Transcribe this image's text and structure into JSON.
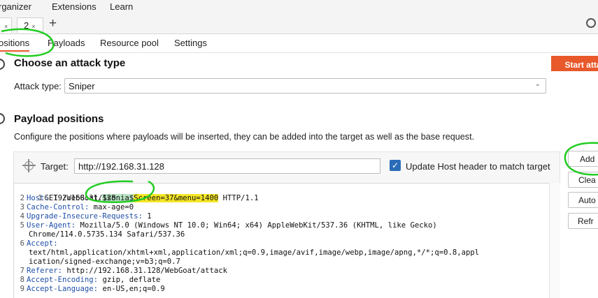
{
  "menu": {
    "items": [
      "rganizer",
      "Extensions",
      "Learn"
    ]
  },
  "intruder_tabs": [
    {
      "label": "",
      "close": "×"
    },
    {
      "label": "2",
      "close": "×"
    }
  ],
  "new_tab_glyph": "+",
  "sub_tabs": [
    "ositions",
    "Payloads",
    "Resource pool",
    "Settings"
  ],
  "attack_section": {
    "heading": "Choose an attack type",
    "start_button": "Start atta",
    "attack_type_label": "Attack type:",
    "attack_type_value": "Sniper"
  },
  "payload_section": {
    "heading": "Payload positions",
    "description": "Configure the positions where payloads will be inserted, they can be added into the target as well as the base request.",
    "target_label": "Target:",
    "target_value": "http://192.168.31.128",
    "update_host_label": "Update Host header to match target",
    "update_host_checked": true,
    "side_buttons": [
      "Add",
      "Clea",
      "Auto",
      "Refr"
    ]
  },
  "request": {
    "line1": {
      "num": "1",
      "pre": "GET /WebGoat/",
      "marker1": "$sonia$",
      "marker2": "Screen=37&menu=1400",
      "post": " HTTP/1.1"
    },
    "lines": [
      {
        "num": "2",
        "name": "Host:",
        "value": " 192.168.31.128"
      },
      {
        "num": "3",
        "name": "Cache-Control:",
        "value": " max-age=0"
      },
      {
        "num": "4",
        "name": "Upgrade-Insecure-Requests:",
        "value": " 1"
      },
      {
        "num": "5",
        "name": "User-Agent:",
        "value": " Mozilla/5.0 (Windows NT 10.0; Win64; x64) AppleWebKit/537.36 (KHTML, like Gecko)"
      },
      {
        "num": "",
        "name": "",
        "value": "Chrome/114.0.5735.134 Safari/537.36"
      },
      {
        "num": "6",
        "name": "Accept:",
        "value": ""
      },
      {
        "num": "",
        "name": "",
        "value": "text/html,application/xhtml+xml,application/xml;q=0.9,image/avif,image/webp,image/apng,*/*;q=0.8,appl"
      },
      {
        "num": "",
        "name": "",
        "value": "ication/signed-exchange;v=b3;q=0.7"
      },
      {
        "num": "7",
        "name": "Referer:",
        "value": " http://192.168.31.128/WebGoat/attack"
      },
      {
        "num": "8",
        "name": "Accept-Encoding:",
        "value": " gzip, deflate"
      },
      {
        "num": "9",
        "name": "Accept-Language:",
        "value": " en-US,en;q=0.9"
      }
    ]
  },
  "colors": {
    "accent": "#e8582a",
    "checkbox": "#2b6cb8",
    "annotation": "#22cc22",
    "highlight_yellow": "#f5e626",
    "header_name": "#1f4fa8"
  }
}
